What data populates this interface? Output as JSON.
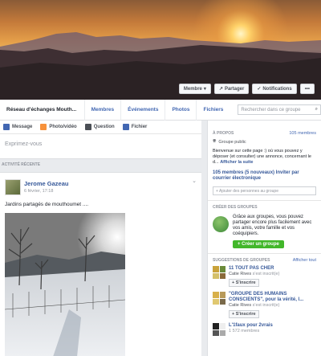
{
  "colors": {
    "link": "#365899",
    "accent": "#4267b2",
    "green": "#42b72a",
    "page_bg": "#e9ebee"
  },
  "cover": {
    "buttons": [
      {
        "label": "Membre",
        "icon": "caret-down-icon"
      },
      {
        "label": "Partager",
        "icon": "share-icon"
      },
      {
        "label": "Notifications",
        "icon": "check-icon"
      },
      {
        "label": "•••",
        "icon": "more-icon"
      }
    ]
  },
  "nav": {
    "group_name": "Réseau d'échanges Mouth...",
    "tabs": [
      "Membres",
      "Événements",
      "Photos",
      "Fichiers"
    ],
    "search_placeholder": "Rechercher dans ce groupe"
  },
  "composer": {
    "tabs": [
      {
        "label": "Message",
        "color": "#4267b2",
        "icon": "pencil-icon"
      },
      {
        "label": "Photo/vidéo",
        "color": "#f7923b",
        "icon": "photo-icon"
      },
      {
        "label": "Question",
        "color": "#4b4f56",
        "icon": "list-icon"
      },
      {
        "label": "Fichier",
        "color": "#4267b2",
        "icon": "file-icon"
      }
    ],
    "placeholder": "Exprimez-vous"
  },
  "feed": {
    "section_label": "ACTIVITÉ RÉCENTE",
    "post": {
      "author": "Jerome Gazeau",
      "date": "6 février, 17:18",
      "text": "Jardins partagés de mouthoumet ...."
    }
  },
  "about": {
    "heading": "À PROPOS",
    "members_count": "105 membres",
    "privacy": "Groupe public",
    "description": "Bienvenue sur cette page :) où vous pouvez y déposer (et consulter) une annonce, concernant le d...",
    "show_more": "Afficher la suite",
    "members_summary": "105 membres (5 nouveaux)",
    "invite": "Inviter par courrier électronique",
    "add_placeholder": "+ Ajouter des personnes au groupe"
  },
  "create_groups": {
    "heading": "CRÉER DES GROUPES",
    "text": "Grâce aux groupes, vous pouvez partager encore plus facilement avec vos amis, votre famille et vos coéquipiers.",
    "button": "+ Créer un groupe"
  },
  "suggestions": {
    "heading": "SUGGESTIONS DE GROUPES",
    "show_all": "Afficher tout",
    "items": [
      {
        "title": "11 TOUT PAS CHER",
        "member": "Catie Rives",
        "member_suffix": " s'est inscrit(e)",
        "join": "+ S'inscrire"
      },
      {
        "title": "\"GROUPE DES HUMAINS CONSCIENTS\", pour la vérité, l...",
        "member": "Catie Rives",
        "member_suffix": " s'est inscrit(e)",
        "join": "+ S'inscrire"
      },
      {
        "title": "L'1faux pour 2vrais",
        "member": "1 572 membres",
        "member_suffix": "",
        "join": ""
      }
    ]
  }
}
